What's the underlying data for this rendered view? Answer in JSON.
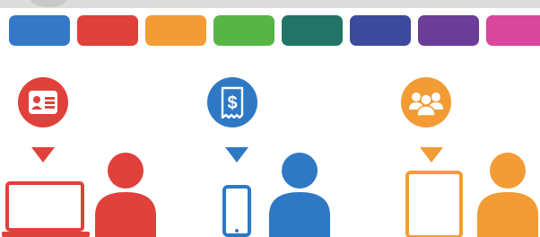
{
  "palette": [
    {
      "name": "blue",
      "color": "#3578c6"
    },
    {
      "name": "red",
      "color": "#e0413a"
    },
    {
      "name": "orange",
      "color": "#f39b34"
    },
    {
      "name": "green",
      "color": "#57b547"
    },
    {
      "name": "teal",
      "color": "#227566"
    },
    {
      "name": "indigo",
      "color": "#3d4a9e"
    },
    {
      "name": "purple",
      "color": "#6a3d96"
    },
    {
      "name": "pink",
      "color": "#d8479c"
    }
  ],
  "scenes": [
    {
      "device": "laptop",
      "badge_icon": "id-card-icon",
      "color": "#e0413a"
    },
    {
      "device": "phone",
      "badge_icon": "dollar-receipt-icon",
      "color": "#2f78c4"
    },
    {
      "device": "tablet",
      "badge_icon": "group-people-icon",
      "color": "#f39b34"
    }
  ]
}
